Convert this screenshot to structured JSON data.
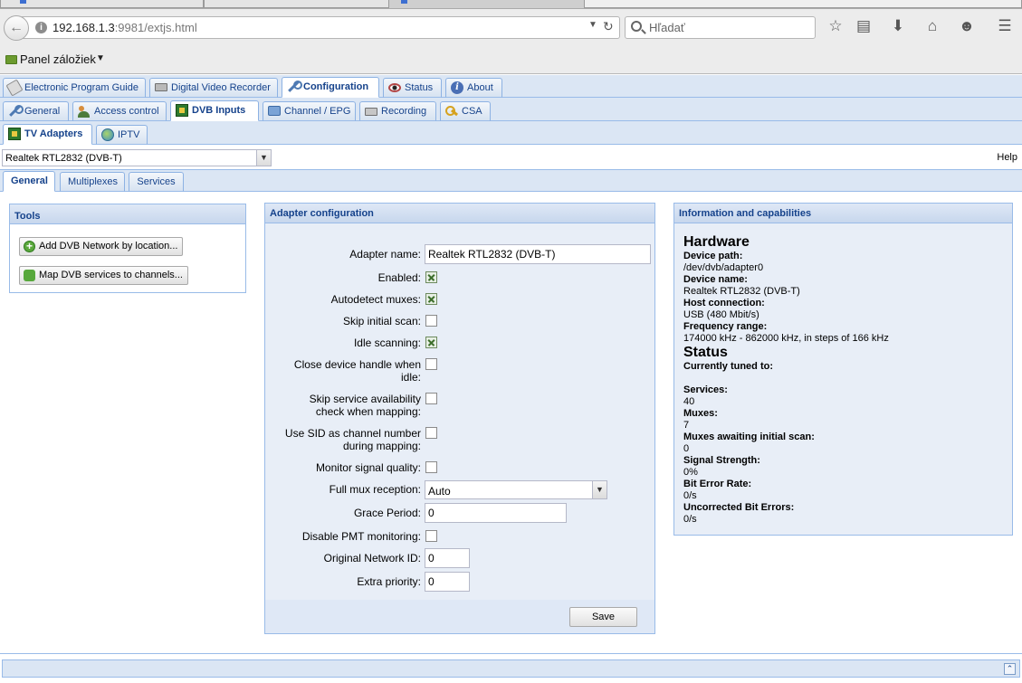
{
  "browser": {
    "url_host": "192.168.1.3",
    "url_rest": ":9981/extjs.html",
    "search_placeholder": "Hľadať",
    "bookmarks_label": "Panel záložiek"
  },
  "tabs_main": [
    {
      "label": "Electronic Program Guide",
      "icon": "book-icon"
    },
    {
      "label": "Digital Video Recorder",
      "icon": "dvr-icon"
    },
    {
      "label": "Configuration",
      "icon": "wrench-icon"
    },
    {
      "label": "Status",
      "icon": "eye-icon"
    },
    {
      "label": "About",
      "icon": "info-icon"
    }
  ],
  "tabs_config": [
    {
      "label": "General",
      "icon": "wrench-icon"
    },
    {
      "label": "Access control",
      "icon": "users-icon"
    },
    {
      "label": "DVB Inputs",
      "icon": "card-icon"
    },
    {
      "label": "Channel / EPG",
      "icon": "tv-icon"
    },
    {
      "label": "Recording",
      "icon": "disk-icon"
    },
    {
      "label": "CSA",
      "icon": "key-icon"
    }
  ],
  "tabs_dvb": [
    {
      "label": "TV Adapters",
      "icon": "card-icon"
    },
    {
      "label": "IPTV",
      "icon": "globe-icon"
    }
  ],
  "adapter_combo": "Realtek RTL2832 (DVB-T)",
  "help": "Help",
  "tabs_adapter": [
    {
      "label": "General"
    },
    {
      "label": "Multiplexes"
    },
    {
      "label": "Services"
    }
  ],
  "tools": {
    "title": "Tools",
    "add_network": "Add DVB Network by location...",
    "map_services": "Map DVB services to channels..."
  },
  "adapter_config": {
    "title": "Adapter configuration",
    "name_label": "Adapter name:",
    "name_value": "Realtek RTL2832 (DVB-T)",
    "enabled_label": "Enabled:",
    "autodetect_label": "Autodetect muxes:",
    "skip_scan_label": "Skip initial scan:",
    "idle_scan_label": "Idle scanning:",
    "close_handle_label_1": "Close device handle when",
    "close_handle_label_2": "idle:",
    "skip_avail_label_1": "Skip service availability",
    "skip_avail_label_2": "check when mapping:",
    "use_sid_label_1": "Use SID as channel number",
    "use_sid_label_2": "during mapping:",
    "monitor_label": "Monitor signal quality:",
    "fullmux_label": "Full mux reception:",
    "fullmux_value": "Auto",
    "grace_label": "Grace Period:",
    "grace_value": "0",
    "disable_pmt_label": "Disable PMT monitoring:",
    "onid_label": "Original Network ID:",
    "onid_value": "0",
    "extra_prio_label": "Extra priority:",
    "extra_prio_value": "0",
    "save": "Save"
  },
  "info": {
    "title": "Information and capabilities",
    "hardware": "Hardware",
    "device_path_k": "Device path:",
    "device_path_v": "/dev/dvb/adapter0",
    "device_name_k": "Device name:",
    "device_name_v": "Realtek RTL2832 (DVB-T)",
    "host_conn_k": "Host connection:",
    "host_conn_v": "USB (480 Mbit/s)",
    "freq_k": "Frequency range:",
    "freq_v": "174000 kHz - 862000 kHz, in steps of 166 kHz",
    "status": "Status",
    "tuned_k": "Currently tuned to:",
    "services_k": "Services:",
    "services_v": "40",
    "muxes_k": "Muxes:",
    "muxes_v": "7",
    "muxes_await_k": "Muxes awaiting initial scan:",
    "muxes_await_v": "0",
    "signal_k": "Signal Strength:",
    "signal_v": "0%",
    "ber_k": "Bit Error Rate:",
    "ber_v": "0/s",
    "unc_k": "Uncorrected Bit Errors:",
    "unc_v": "0/s"
  }
}
